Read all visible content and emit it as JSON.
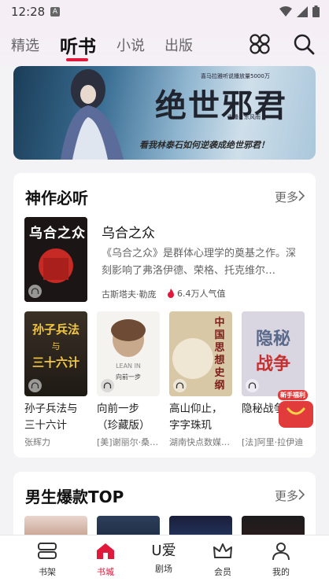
{
  "status": {
    "time": "12:28",
    "notif_letter": "A"
  },
  "nav": {
    "tabs": [
      "精选",
      "听书",
      "小说",
      "出版"
    ],
    "active_tab": "听书"
  },
  "banner": {
    "title": "绝世邪君",
    "tagline_small": "喜马拉雅听说播放量5000万",
    "host": "主播：东风雨",
    "slogan": "看我林泰石如何逆袭成绝世邪君！"
  },
  "section1": {
    "title": "神作必听",
    "more": "更多",
    "featured": {
      "cover_title": "乌合之众",
      "name": "乌合之众",
      "desc": "《乌合之众》是群体心理学的奠基之作。深刻影响了弗洛伊德、荣格、托克维尔…",
      "author": "古斯塔夫·勒庞",
      "popularity": "6.4万人气值"
    },
    "books": [
      {
        "title": "孙子兵法与三十六计",
        "author": "张辉力",
        "cover_text": "孙子兵法 三十六计"
      },
      {
        "title": "向前一步（珍藏版）",
        "author": "[美]谢丽尔·桑…",
        "cover_text": "LEAN IN 向前一步"
      },
      {
        "title": "高山仰止，字字珠玑—…",
        "author": "湖南快点数媒…",
        "cover_text": "中国思想史纲"
      },
      {
        "title": "隐秘战争",
        "author": "[法]阿里·拉伊迪",
        "cover_text": "隐秘战争"
      }
    ]
  },
  "gift_badge": "新手福利",
  "section2": {
    "title": "男生爆款TOP",
    "more": "更多"
  },
  "bottom_nav": [
    {
      "label": "书架",
      "icon": "bookshelf-icon"
    },
    {
      "label": "书城",
      "icon": "home-icon"
    },
    {
      "label": "剧场",
      "icon": "theater-icon",
      "glyph": "U爱"
    },
    {
      "label": "会员",
      "icon": "vip-crown-icon"
    },
    {
      "label": "我的",
      "icon": "profile-icon"
    }
  ],
  "colors": {
    "accent": "#e0183b",
    "background": "#f3f3f5"
  }
}
